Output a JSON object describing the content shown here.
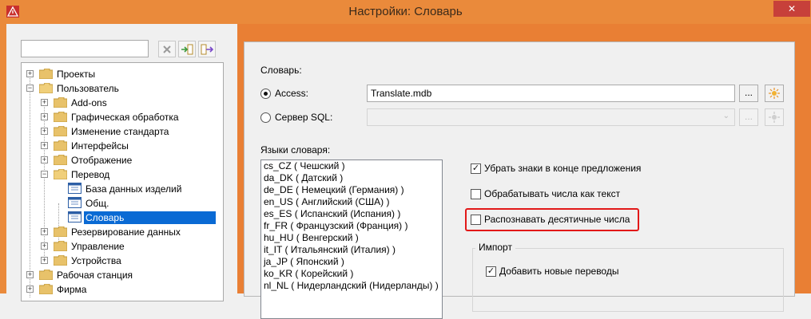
{
  "window": {
    "title": "Настройки: Словарь",
    "close_label": "✕"
  },
  "left": {
    "search": {
      "value": "",
      "placeholder": ""
    },
    "tree": [
      {
        "label": "Проекты"
      },
      {
        "label": "Пользователь"
      },
      {
        "label": "Add-ons"
      },
      {
        "label": "Графическая обработка"
      },
      {
        "label": "Изменение стандарта"
      },
      {
        "label": "Интерфейсы"
      },
      {
        "label": "Отображение"
      },
      {
        "label": "Перевод"
      },
      {
        "label": "База данных изделий"
      },
      {
        "label": "Общ."
      },
      {
        "label": "Словарь"
      },
      {
        "label": "Резервирование данных"
      },
      {
        "label": "Управление"
      },
      {
        "label": "Устройства"
      },
      {
        "label": "Рабочая станция"
      },
      {
        "label": "Фирма"
      }
    ]
  },
  "dictionary": {
    "section_label": "Словарь:",
    "access_label": "Access:",
    "access_value": "Translate.mdb",
    "sql_label": "Сервер SQL:",
    "browse_label": "...",
    "languages_label": "Языки словаря:",
    "languages": [
      "cs_CZ ( Чешский )",
      "da_DK ( Датский )",
      "de_DE ( Немецкий (Германия) )",
      "en_US ( Английский (США) )",
      "es_ES ( Испанский (Испания) )",
      "fr_FR ( Французский (Франция) )",
      "hu_HU ( Венгерский )",
      "it_IT ( Итальянский (Италия) )",
      "ja_JP ( Японский )",
      "ko_KR ( Корейский )",
      "nl_NL ( Нидерландский (Нидерланды) )"
    ],
    "options": {
      "remove_punct": "Убрать знаки в конце предложения",
      "numbers_as_text": "Обрабатывать числа как текст",
      "decimal_numbers": "Распознавать десятичные числа"
    },
    "import": {
      "title": "Импорт",
      "add_new": "Добавить новые переводы"
    }
  },
  "colors": {
    "accent": "#ea8a3b",
    "selection": "#0a6ad4",
    "highlight": "#e21818"
  }
}
